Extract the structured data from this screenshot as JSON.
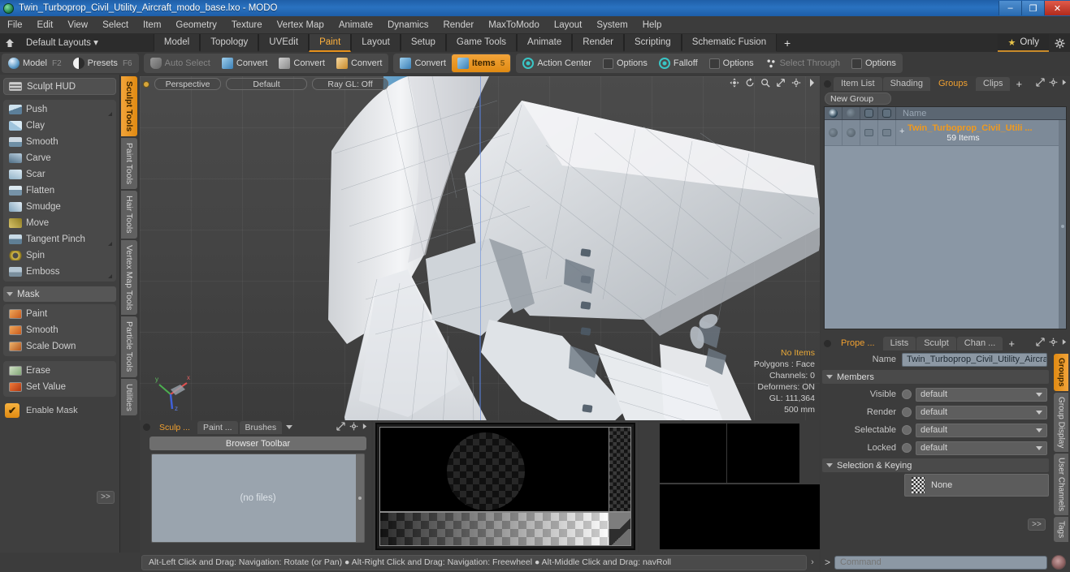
{
  "window": {
    "title": "Twin_Turboprop_Civil_Utility_Aircraft_modo_base.lxo - MODO",
    "minimize": "–",
    "maximize": "❐",
    "close": "✕"
  },
  "menubar": {
    "items": [
      "File",
      "Edit",
      "View",
      "Select",
      "Item",
      "Geometry",
      "Texture",
      "Vertex Map",
      "Animate",
      "Dynamics",
      "Render",
      "MaxToModo",
      "Layout",
      "System",
      "Help"
    ]
  },
  "layoutbar": {
    "layouts_label": "Default Layouts ▾",
    "tabs": [
      "Model",
      "Topology",
      "UVEdit",
      "Paint",
      "Layout",
      "Setup",
      "Game Tools",
      "Animate",
      "Render",
      "Scripting",
      "Schematic Fusion"
    ],
    "active_tab": "Paint",
    "plus": "+",
    "only_label": "Only",
    "star_glyph": "★"
  },
  "modebar": {
    "group1": [
      {
        "label": "Model",
        "shortcut": "F2",
        "icon": "sphere-icon"
      },
      {
        "label": "Presets",
        "shortcut": "F6",
        "icon": "half-sphere-icon"
      }
    ],
    "group2": [
      {
        "label": "Auto Select",
        "shortcut": "",
        "icon": "shield-icon",
        "dim": true
      },
      {
        "label": "Convert",
        "shortcut": "",
        "icon": "cube-blue-icon"
      },
      {
        "label": "Convert",
        "shortcut": "",
        "icon": "cube-gray-icon"
      },
      {
        "label": "Convert",
        "shortcut": "",
        "icon": "cube-orange-icon"
      }
    ],
    "group3": [
      {
        "label": "Convert",
        "shortcut": "",
        "icon": "cube-blue-icon"
      },
      {
        "label": "Items",
        "shortcut": "5",
        "icon": "cube-blue-icon",
        "active": true
      }
    ],
    "group4": [
      {
        "label": "Action Center",
        "shortcut": "",
        "icon": "target-icon"
      },
      {
        "label": "Options",
        "shortcut": "",
        "icon": "checkbox-icon"
      },
      {
        "label": "Falloff",
        "shortcut": "",
        "icon": "target-icon"
      },
      {
        "label": "Options",
        "shortcut": "",
        "icon": "checkbox-icon"
      },
      {
        "label": "Select Through",
        "shortcut": "",
        "icon": "dots-icon",
        "dim": true
      },
      {
        "label": "Options",
        "shortcut": "",
        "icon": "checkbox-icon"
      }
    ]
  },
  "left_panel": {
    "hud_label": "Sculpt HUD",
    "sculpt_tools": [
      {
        "label": "Push",
        "icon": "brush-push-icon",
        "has_corner": true
      },
      {
        "label": "Clay",
        "icon": "brush-clay-icon",
        "has_corner": false
      },
      {
        "label": "Smooth",
        "icon": "brush-smooth-icon",
        "has_corner": false
      },
      {
        "label": "Carve",
        "icon": "brush-carve-icon",
        "has_corner": false
      },
      {
        "label": "Scar",
        "icon": "brush-scar-icon",
        "has_corner": false
      },
      {
        "label": "Flatten",
        "icon": "brush-flatten-icon",
        "has_corner": false
      },
      {
        "label": "Smudge",
        "icon": "brush-smudge-icon",
        "has_corner": false
      },
      {
        "label": "Move",
        "icon": "brush-move-icon",
        "has_corner": false
      },
      {
        "label": "Tangent Pinch",
        "icon": "brush-tangent-pinch-icon",
        "has_corner": true
      },
      {
        "label": "Spin",
        "icon": "brush-spin-icon",
        "has_corner": false
      },
      {
        "label": "Emboss",
        "icon": "brush-emboss-icon",
        "has_corner": true
      }
    ],
    "mask_section": "Mask",
    "mask_tools": [
      {
        "label": "Paint",
        "icon": "mask-paint-icon"
      },
      {
        "label": "Smooth",
        "icon": "mask-smooth-icon"
      },
      {
        "label": "Scale Down",
        "icon": "mask-scale-down-icon"
      }
    ],
    "mask_tools2": [
      {
        "label": "Erase",
        "icon": "mask-erase-icon"
      },
      {
        "label": "Set Value",
        "icon": "mask-set-value-icon"
      }
    ],
    "enable_mask_label": "Enable Mask",
    "enable_mask_checked": true,
    "more_label": ">>"
  },
  "vertical_tabs_left": {
    "items": [
      "Sculpt Tools",
      "Paint Tools",
      "Hair Tools",
      "Vertex Map Tools",
      "Particle Tools",
      "Utilities"
    ],
    "active": "Sculpt Tools"
  },
  "viewport": {
    "view_mode": "Perspective",
    "shading": "Default",
    "raygl": "Ray GL: Off",
    "stats": {
      "items": "No Items",
      "polygons": "Polygons : Face",
      "channels": "Channels: 0",
      "deformers": "Deformers: ON",
      "gl": "GL: 111,364",
      "scale": "500 mm"
    },
    "axis_labels": {
      "x": "x",
      "y": "y",
      "z": "z"
    }
  },
  "browser_panel": {
    "tabs": [
      {
        "label": "Sculp ...",
        "active": true
      },
      {
        "label": "Paint ...",
        "active": false
      },
      {
        "label": "Brushes",
        "active": false
      }
    ],
    "toolbar_label": "Browser Toolbar",
    "empty_label": "(no files)"
  },
  "right_panel": {
    "tabs": [
      {
        "label": "Item List",
        "active": false
      },
      {
        "label": "Shading",
        "active": false
      },
      {
        "label": "Groups",
        "active": true
      },
      {
        "label": "Clips",
        "active": false
      }
    ],
    "plus": "+",
    "new_group_label": "New Group",
    "list_header": {
      "name": "Name",
      "col_icons": [
        "eye-icon",
        "render-icon",
        "selectable-icon",
        "lock-icon"
      ]
    },
    "rows": [
      {
        "name": "Twin_Turboprop_Civil_Utili ...",
        "sub": "59 Items",
        "expand": "+",
        "icon": "group-icon"
      }
    ]
  },
  "properties": {
    "tabs": [
      {
        "label": "Prope ...",
        "active": true
      },
      {
        "label": "Lists",
        "active": false
      },
      {
        "label": "Sculpt",
        "active": false
      },
      {
        "label": "Chan ...",
        "active": false
      }
    ],
    "plus": "+",
    "name_label": "Name",
    "name_value": "Twin_Turboprop_Civil_Utility_Aircra",
    "members_section": "Members",
    "fields": [
      {
        "label": "Visible",
        "value": "default"
      },
      {
        "label": "Render",
        "value": "default"
      },
      {
        "label": "Selectable",
        "value": "default"
      },
      {
        "label": "Locked",
        "value": "default"
      }
    ],
    "selection_section": "Selection & Keying",
    "selection_value": "None",
    "more_label": ">>"
  },
  "vertical_tabs_right": {
    "items": [
      "Groups",
      "Group Display",
      "User Channels",
      "Tags"
    ],
    "active": "Groups"
  },
  "statusbar": {
    "hint": "Alt-Left Click and Drag: Navigation: Rotate (or Pan) ● Alt-Right Click and Drag: Navigation: Freewheel ● Alt-Middle Click and Drag: navRoll",
    "arrow": "›"
  },
  "command": {
    "prefix": ">",
    "placeholder": "Command"
  },
  "colors": {
    "accent_orange": "#e8911b",
    "title_blue": "#2a72c0",
    "panel_bg": "#3c3c3c",
    "list_bg": "#8a97a5"
  }
}
